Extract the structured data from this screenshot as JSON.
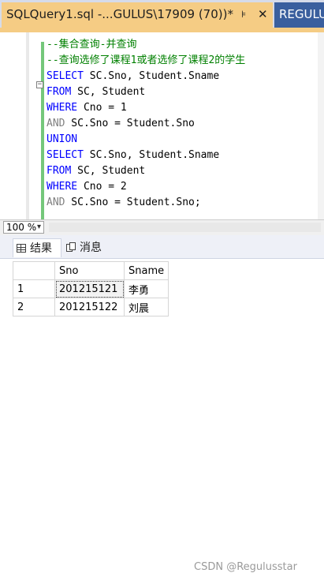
{
  "tabs": {
    "active": {
      "title": "SQLQuery1.sql -...GULUS\\17909 (70))*",
      "pin_glyph": "⊧",
      "close_glyph": "✕"
    },
    "inactive": {
      "title": "REGULUS"
    }
  },
  "editor": {
    "lines": [
      {
        "parts": []
      },
      {
        "parts": [
          {
            "cls": "cm",
            "text": "--集合查询-并查询"
          }
        ]
      },
      {
        "parts": [
          {
            "cls": "cm",
            "text": "--查询选修了课程1或者选修了课程2的学生"
          }
        ]
      },
      {
        "parts": [
          {
            "cls": "kw",
            "text": "SELECT"
          },
          {
            "cls": "tx",
            "text": " SC.Sno, Student.Sname"
          }
        ]
      },
      {
        "parts": [
          {
            "cls": "kw",
            "text": "FROM"
          },
          {
            "cls": "tx",
            "text": " SC, Student"
          }
        ]
      },
      {
        "parts": [
          {
            "cls": "kw",
            "text": "WHERE"
          },
          {
            "cls": "tx",
            "text": " Cno = 1"
          }
        ]
      },
      {
        "parts": [
          {
            "cls": "gray",
            "text": "AND"
          },
          {
            "cls": "tx",
            "text": " SC.Sno = Student.Sno"
          }
        ]
      },
      {
        "parts": [
          {
            "cls": "kw",
            "text": "UNION"
          }
        ]
      },
      {
        "parts": [
          {
            "cls": "kw",
            "text": "SELECT"
          },
          {
            "cls": "tx",
            "text": " SC.Sno, Student.Sname"
          }
        ]
      },
      {
        "parts": [
          {
            "cls": "kw",
            "text": "FROM"
          },
          {
            "cls": "tx",
            "text": " SC, Student"
          }
        ]
      },
      {
        "parts": [
          {
            "cls": "kw",
            "text": "WHERE"
          },
          {
            "cls": "tx",
            "text": " Cno = 2"
          }
        ]
      },
      {
        "parts": [
          {
            "cls": "gray",
            "text": "AND"
          },
          {
            "cls": "tx",
            "text": " SC.Sno = Student.Sno;"
          }
        ]
      }
    ],
    "collapse_glyph": "−"
  },
  "zoom": {
    "value": "100 %",
    "caret": "▾"
  },
  "result_tabs": [
    {
      "label": "结果",
      "icon": "grid-icon"
    },
    {
      "label": "消息",
      "icon": "messages-icon"
    }
  ],
  "results": {
    "columns": [
      "Sno",
      "Sname"
    ],
    "rows": [
      {
        "num": "1",
        "cells": [
          "201215121",
          "李勇"
        ]
      },
      {
        "num": "2",
        "cells": [
          "201215122",
          "刘晨"
        ]
      }
    ]
  },
  "watermark": "CSDN @Regulusstar",
  "colors": {
    "active_tab": "#f5cc84",
    "inactive_tab": "#3a5f9e",
    "keyword": "#0000ff",
    "comment": "#008000",
    "change_bar": "#74c77a"
  }
}
